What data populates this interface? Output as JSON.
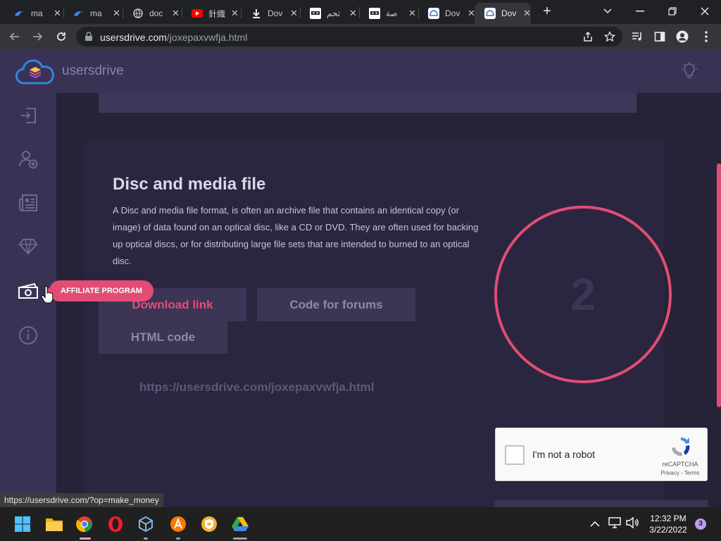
{
  "browser": {
    "tabs": [
      {
        "title": "ma",
        "favicon": "edge-icon"
      },
      {
        "title": "ma",
        "favicon": "edge-icon"
      },
      {
        "title": "doc",
        "favicon": "globe-icon"
      },
      {
        "title": "針織",
        "favicon": "youtube-icon"
      },
      {
        "title": "Dov",
        "favicon": "download-icon"
      },
      {
        "title": "تحم",
        "favicon": "ninja-icon"
      },
      {
        "title": "صة",
        "favicon": "ninja-icon"
      },
      {
        "title": "Dov",
        "favicon": "usersdrive-icon"
      },
      {
        "title": "Dov",
        "favicon": "usersdrive-icon"
      }
    ],
    "active_tab": 8,
    "address": {
      "domain": "usersdrive.com",
      "path": "/joxepaxvwfja.html"
    },
    "status_url": "https://usersdrive.com/?op=make_money"
  },
  "site": {
    "brand": "usersdrive",
    "tooltip": "AFFILIATE PROGRAM",
    "sidebar_icons": [
      "login-icon",
      "add-user-icon",
      "news-icon",
      "diamond-icon",
      "money-icon",
      "info-icon"
    ]
  },
  "content": {
    "title": "Disc and media file",
    "description": "A Disc and media file format, is often an archive file that contains an identical copy (or image) of data found on an optical disc, like a CD or DVD. They are often used for backing up optical discs, or for distributing large file sets that are intended to burned to an optical disc.",
    "buttons": {
      "download": "Download link",
      "forums": "Code for forums",
      "html": "HTML code"
    },
    "link": "https://usersdrive.com/joxepaxvwfja.html",
    "countdown": "2"
  },
  "recaptcha": {
    "label": "I'm not a robot",
    "brand": "reCAPTCHA",
    "links": "Privacy - Terms"
  },
  "taskbar": {
    "apps": [
      "windows-start-icon",
      "file-explorer-icon",
      "chrome-icon",
      "opera-icon",
      "virtualbox-icon",
      "avast-icon",
      "shield-icon",
      "google-drive-icon"
    ],
    "time": "12:32 PM",
    "date": "3/22/2022",
    "notifications": "3"
  },
  "colors": {
    "accent": "#e14d75",
    "sidebar": "#3a3255",
    "page": "#262238"
  }
}
